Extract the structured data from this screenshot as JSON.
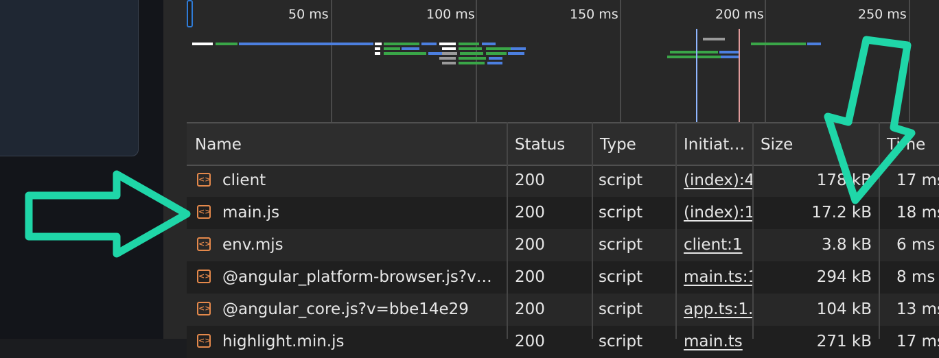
{
  "timeline": {
    "ticks": [
      "50 ms",
      "100 ms",
      "150 ms",
      "200 ms",
      "250 ms"
    ]
  },
  "table": {
    "columns": {
      "name": "Name",
      "status": "Status",
      "type": "Type",
      "initiator": "Initiat…",
      "size": "Size",
      "time": "Time"
    },
    "rows": [
      {
        "name": "client",
        "status": "200",
        "type": "script",
        "initiator": "(index):4",
        "size": "178 kB",
        "time": "17 ms"
      },
      {
        "name": "main.js",
        "status": "200",
        "type": "script",
        "initiator": "(index):1",
        "size": "17.2 kB",
        "time": "18 ms"
      },
      {
        "name": "env.mjs",
        "status": "200",
        "type": "script",
        "initiator": "client:1",
        "size": "3.8 kB",
        "time": "6 ms"
      },
      {
        "name": "@angular_platform-browser.js?v…",
        "status": "200",
        "type": "script",
        "initiator": "main.ts:1",
        "size": "294 kB",
        "time": "8 ms"
      },
      {
        "name": "@angular_core.js?v=bbe14e29",
        "status": "200",
        "type": "script",
        "initiator": "app.ts:1.",
        "size": "104 kB",
        "time": "13 ms"
      },
      {
        "name": "highlight.min.js",
        "status": "200",
        "type": "script",
        "initiator": "main.ts",
        "size": "271 kB",
        "time": "17 ms"
      }
    ]
  },
  "colors": {
    "annotation": "#1fd6a8",
    "waterfall_blue": "#4c7fe0",
    "waterfall_green": "#3aa648",
    "file_icon": "#e5894b"
  }
}
